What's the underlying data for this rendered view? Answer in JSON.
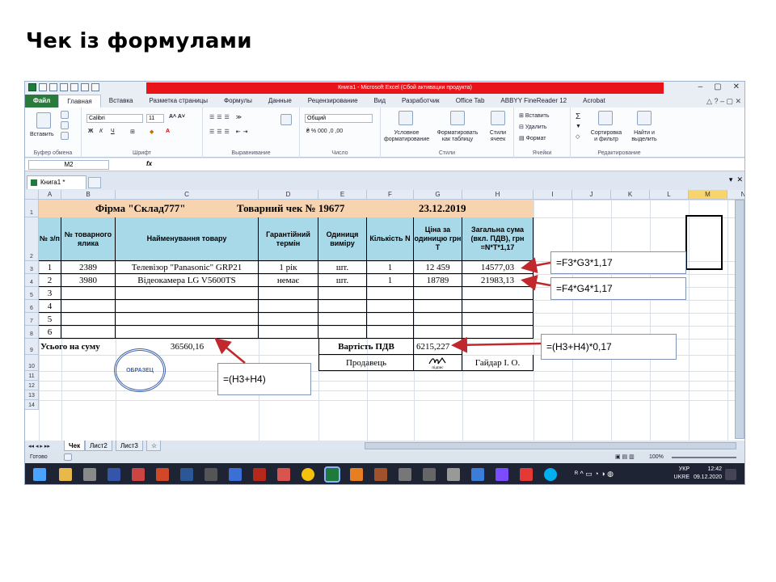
{
  "slide": {
    "title": "Чек  із формулами"
  },
  "window": {
    "title": "Книга1 - Microsoft Excel (Сбой активации продукта)",
    "tabs": [
      "Файл",
      "Главная",
      "Вставка",
      "Разметка страницы",
      "Формулы",
      "Данные",
      "Рецензирование",
      "Вид",
      "Разработчик",
      "Office Tab",
      "ABBYY FineReader 12",
      "Acrobat"
    ]
  },
  "ribbon": {
    "groups": [
      "Буфер обмена",
      "Шрифт",
      "Выравнивание",
      "Число",
      "Стили",
      "Ячейки",
      "Редактирование"
    ],
    "paste": "Вставить",
    "font_name": "Calibri",
    "font_size": "11",
    "number_format": "Общий",
    "cond_format": "Условное форматирование",
    "format_table": "Форматировать как таблицу",
    "cell_styles": "Стили ячеек",
    "insert": "Вставить",
    "delete": "Удалить",
    "format": "Формат",
    "sort": "Сортировка и фильтр",
    "find": "Найти и выделить"
  },
  "formula_bar": {
    "name_box": "M2",
    "fx": "fx"
  },
  "workbook_tab": "Книга1 *",
  "columns": [
    "A",
    "B",
    "C",
    "D",
    "E",
    "F",
    "G",
    "H",
    "I",
    "J",
    "K",
    "L",
    "M",
    "N"
  ],
  "rows": [
    "1",
    "2",
    "3",
    "4",
    "5",
    "6",
    "7",
    "8",
    "9",
    "10",
    "11",
    "12",
    "13",
    "14"
  ],
  "sheet": {
    "header": {
      "firm": "Фірма \"Склад777\"",
      "check": "Товарний чек № 19677",
      "date": "23.12.2019"
    },
    "col_headers": [
      "№ з/п",
      "№ товарного ялика",
      "Найменування товару",
      "Гарантійний термін",
      "Одиниця виміру",
      "Кількість N",
      "Ціна за одиницю грн Т",
      "Загальна сума (вкл. ПДВ), грн =N*T*1,17"
    ],
    "items": [
      {
        "n": "1",
        "code": "2389",
        "name": "Телевізор \"Panasonic\" GRP21",
        "warranty": "1 рік",
        "unit": "шт.",
        "qty": "1",
        "price": "12 459",
        "total": "14577,03"
      },
      {
        "n": "2",
        "code": "3980",
        "name": "Відеокамера LG V5600TS",
        "warranty": "немає",
        "unit": "шт.",
        "qty": "1",
        "price": "18789",
        "total": "21983,13"
      }
    ],
    "empty_rows": [
      "3",
      "4",
      "5",
      "6"
    ],
    "total_label": "Усього на суму",
    "total_value": "36560,16",
    "vat_label": "Вартість ПДВ",
    "vat_value": "6215,227",
    "seller_label": "Продавець",
    "seller_name": "Гайдар І. О.",
    "signature_caption": "підпис",
    "stamp_text": "ОБРАЗЕЦ"
  },
  "callouts": [
    "=F3*G3*1,17",
    "=F4*G4*1,17",
    "=(H3+H4)*0,17",
    "=(H3+H4)"
  ],
  "sheet_tabs": [
    "Чек",
    "Лист2",
    "Лист3"
  ],
  "status": {
    "ready": "Готово",
    "zoom": "100%"
  },
  "tray": {
    "lang": "УКР",
    "lang2": "UKRE",
    "time": "12:42",
    "date": "09.12.2020"
  }
}
